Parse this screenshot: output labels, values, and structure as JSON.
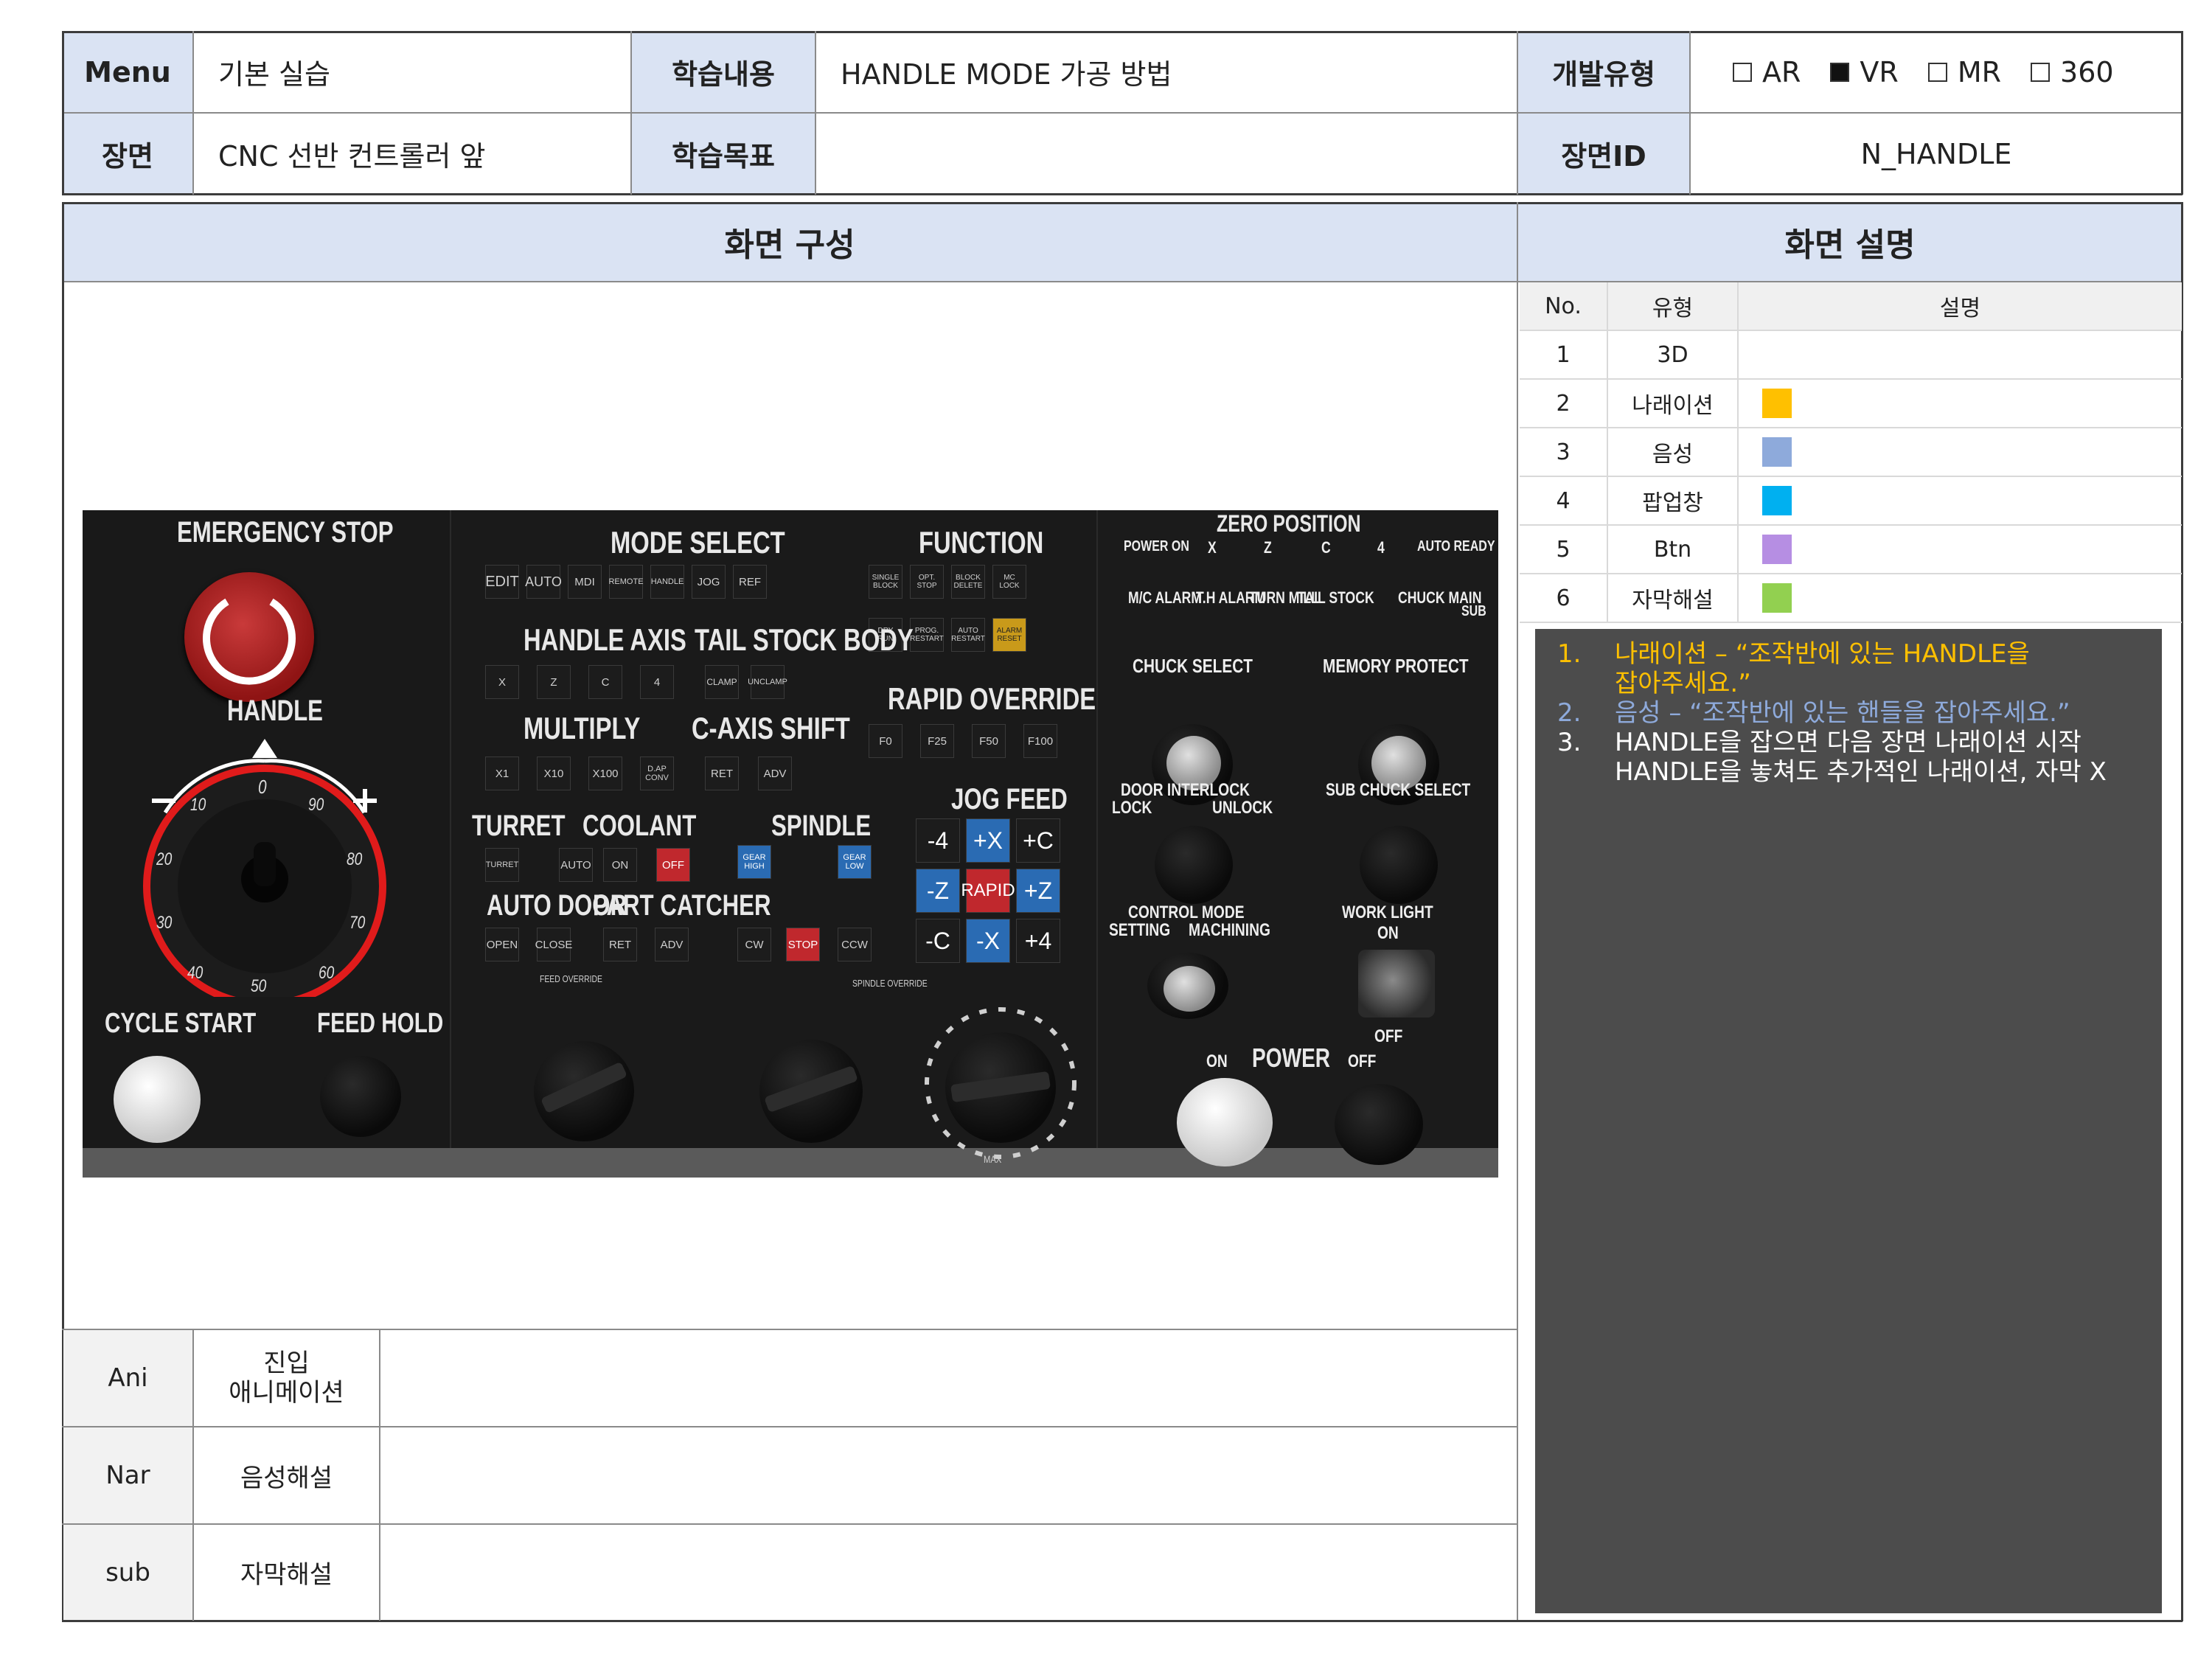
{
  "header": {
    "menu_label": "Menu",
    "menu_value": "기본 실습",
    "content_label": "학습내용",
    "content_value": "HANDLE MODE 가공 방법",
    "devtype_label": "개발유형",
    "devtype_options": [
      {
        "label": "AR",
        "checked": false
      },
      {
        "label": "VR",
        "checked": true
      },
      {
        "label": "MR",
        "checked": false
      },
      {
        "label": "360",
        "checked": false
      }
    ],
    "scene_label": "장면",
    "scene_value": "CNC 선반 컨트롤러 앞",
    "goal_label": "학습목표",
    "goal_value": "",
    "sceneid_label": "장면ID",
    "sceneid_value": "N_HANDLE"
  },
  "sections": {
    "screen_title": "화면 구성",
    "desc_title": "화면 설명"
  },
  "legend": {
    "headers": [
      "No.",
      "유형",
      "설명"
    ],
    "rows": [
      {
        "no": "1",
        "type": "3D",
        "color": ""
      },
      {
        "no": "2",
        "type": "나래이션",
        "color": "#ffc000"
      },
      {
        "no": "3",
        "type": "음성",
        "color": "#8eaadb"
      },
      {
        "no": "4",
        "type": "팝업창",
        "color": "#00b0f0"
      },
      {
        "no": "5",
        "type": "Btn",
        "color": "#b68ee3"
      },
      {
        "no": "6",
        "type": "자막해설",
        "color": "#92d050"
      }
    ]
  },
  "description": {
    "items": [
      {
        "num": "1.",
        "lines": [
          "나래이션 – “조작반에 있는 HANDLE을",
          "잡아주세요.”"
        ],
        "color": "#ffc000"
      },
      {
        "num": "2.",
        "lines": [
          "음성 – “조작반에 있는 핸들을 잡아주세요.”"
        ],
        "color": "#8eaadb"
      },
      {
        "num": "3.",
        "lines": [
          "HANDLE을 잡으면 다음 장면 나래이션 시작",
          "HANDLE을 놓쳐도 추가적인 나래이션, 자막 X"
        ],
        "color": "#ffffff"
      }
    ]
  },
  "bottom": {
    "rows": [
      {
        "key": "Ani",
        "label": "진입\n애니메이션",
        "value": ""
      },
      {
        "key": "Nar",
        "label": "음성해설",
        "value": ""
      },
      {
        "key": "sub",
        "label": "자막해설",
        "value": ""
      }
    ]
  },
  "panel": {
    "emergency_stop": "EMERGENCY STOP",
    "handle": "HANDLE",
    "cycle_start": "CYCLE START",
    "feed_hold": "FEED HOLD",
    "mode_select": "MODE SELECT",
    "mode_buttons": [
      "EDIT",
      "AUTO",
      "MDI",
      "REMOTE",
      "HANDLE",
      "JOG",
      "REF"
    ],
    "function": "FUNCTION",
    "function_buttons_1": [
      "SINGLE BLOCK",
      "OPT. STOP",
      "BLOCK DELETE",
      "MC LOCK"
    ],
    "function_buttons_2": [
      "DRY RUN",
      "PROG. RESTART",
      "AUTO RESTART",
      "ALARM RESET"
    ],
    "handle_axis": "HANDLE AXIS",
    "handle_axis_buttons": [
      "X",
      "Z",
      "C",
      "4"
    ],
    "tail_stock_body": "TAIL STOCK BODY",
    "tail_buttons": [
      "CLAMP",
      "UNCLAMP"
    ],
    "rapid_override": "RAPID OVERRIDE",
    "rapid_buttons": [
      "F0",
      "F25",
      "F50",
      "F100"
    ],
    "multiply": "MULTIPLY",
    "multiply_buttons": [
      "X1",
      "X10",
      "X100",
      "D.AP CONV"
    ],
    "c_axis_shift": "C-AXIS SHIFT",
    "c_axis_buttons": [
      "RET",
      "ADV"
    ],
    "jog_feed": "JOG FEED",
    "jog_buttons": [
      "-4",
      "+X",
      "+C",
      "-Z",
      "RAPID",
      "+Z",
      "-C",
      "-X",
      "+4"
    ],
    "turret": "TURRET",
    "coolant": "COOLANT",
    "spindle": "SPINDLE",
    "turret_buttons": [
      "TURRET",
      "AUTO",
      "ON",
      "OFF"
    ],
    "spindle_top_buttons": [
      "GEAR HIGH",
      "GEAR LOW"
    ],
    "auto_door": "AUTO DOOR",
    "part_catcher": "PART CATCHER",
    "door_buttons": [
      "OPEN",
      "CLOSE",
      "RET",
      "ADV"
    ],
    "spindle_buttons": [
      "CW",
      "STOP",
      "CCW"
    ],
    "feed_override": "FEED OVERRIDE",
    "spindle_override": "SPINDLE OVERRIDE",
    "max": "MAX",
    "zero_position": "ZERO POSITION",
    "zero_labels": [
      "POWER ON",
      "X",
      "Z",
      "C",
      "4",
      "AUTO READY"
    ],
    "alarm_labels": [
      "M/C ALARM",
      "T.H ALARM",
      "TURN MILL",
      "TAIL STOCK",
      "CHUCK MAIN",
      "SUB"
    ],
    "chuck_select": "CHUCK SELECT",
    "memory_protect": "MEMORY PROTECT",
    "door_interlock": "DOOR INTERLOCK",
    "lock": "LOCK",
    "unlock": "UNLOCK",
    "sub_chuck_select": "SUB CHUCK SELECT",
    "control_mode": "CONTROL MODE",
    "setting": "SETTING",
    "machining": "MACHINING",
    "work_light": "WORK LIGHT",
    "on": "ON",
    "off": "OFF",
    "power": "POWER",
    "handle_dial": [
      "0",
      "90",
      "80",
      "70",
      "60",
      "50",
      "40",
      "30",
      "20",
      "10"
    ]
  }
}
